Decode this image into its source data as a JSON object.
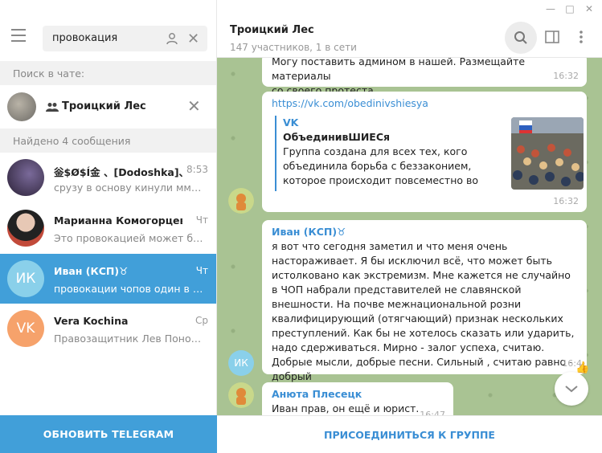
{
  "window": {
    "minimize": "—",
    "maximize": "□",
    "close": "✕"
  },
  "sidebar": {
    "search_value": "провокация",
    "search_in_chat_label": "Поиск в чате:",
    "chat_filter_name": "Троицкий Лес",
    "found_label": "Найдено 4 сообщения",
    "results": [
      {
        "title": "釡$Ø$Í金 、[Dodoshka]、",
        "time": "8:53",
        "snippet": "срузу в основу кинули мммм...",
        "avatar_color": "#3b3050"
      },
      {
        "title": "Марианна Комогорцева",
        "time": "Чт",
        "snippet": "Это провокацией может быть",
        "avatar_color": "#a8523f"
      },
      {
        "title": "Иван (КСП)♉",
        "time": "Чт",
        "snippet": "провокации чопов один в од...",
        "avatar_initials": "ИК",
        "avatar_color": "#8ad0ea"
      },
      {
        "title": "Vera Kochina",
        "time": "Ср",
        "snippet": "Правозащитник Лев Пономa...",
        "avatar_initials": "VK",
        "avatar_color": "#f6a26b"
      }
    ],
    "update_button": "ОБНОВИТЬ TELEGRAM"
  },
  "chat": {
    "title": "Троицкий Лес",
    "subtitle": "147 участников, 1 в сети",
    "messages": [
      {
        "text_line1": "Могу поставить админом в нашей. Размещайте материалы",
        "text_line2": "со своего протеста.",
        "time": "16:32"
      },
      {
        "link": "https://vk.com/obedinivshiesya",
        "preview_site": "VK",
        "preview_title": "ОбъединивШИЕСя",
        "preview_desc": "Группа создана для всех тех, кого объединила борьба с беззаконием, которое происходит повсеместно во всей…",
        "time": "16:32"
      },
      {
        "sender": "Иван (КСП)♉",
        "text": "я вот что сегодня заметил и что меня очень настораживает. Я бы исключил всё, что может быть истолковано как экстремизм. Мне кажется не случайно в ЧОП набрали представителей не славянской внешности. На почве межнациональной розни квалифицирующий (отягчающий) признак нескольких преступлений.    Как бы не хотелось сказать или ударить, надо сдерживаться. Мирно - залог успеха, считаю.  Добрые мысли, добрые песни.  Сильный , считаю равно - добрый",
        "time": "16:4",
        "avatar_initials": "ИК"
      },
      {
        "sender": "Анюта Плесецк",
        "text": "Иван прав, он ещё и юрист.",
        "time": "16:47"
      }
    ],
    "reaction": "👍",
    "join_button": "ПРИСОЕДИНИТЬСЯ К ГРУППЕ"
  },
  "colors": {
    "accent": "#419fd9",
    "chat_bg": "#a9c393",
    "link": "#3a8ed4"
  }
}
